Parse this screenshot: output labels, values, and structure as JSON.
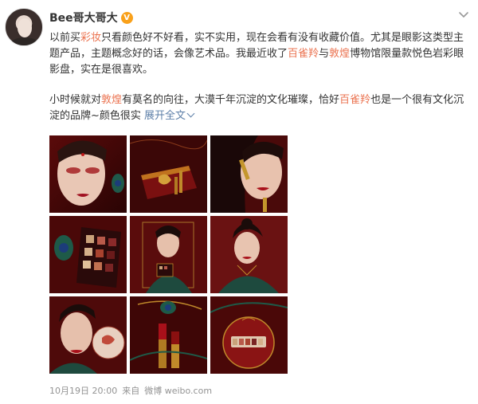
{
  "author": {
    "name": "Bee哥大哥大",
    "verified_badge": "V"
  },
  "post": {
    "p1": [
      {
        "t": "以前买",
        "kw": false
      },
      {
        "t": "彩妆",
        "kw": true
      },
      {
        "t": "只看颜色好不好看，实不实用，现在会看有没有收藏价值。尤其是眼影这类型主题产品，主题概念好的话，会像艺术品。我最近收了",
        "kw": false
      },
      {
        "t": "百雀羚",
        "kw": true
      },
      {
        "t": "与",
        "kw": false
      },
      {
        "t": "敦煌",
        "kw": true
      },
      {
        "t": "博物馆限量款悦色岩彩眼影盘，实在是很喜欢。",
        "kw": false
      }
    ],
    "p2": [
      {
        "t": "小时候就对",
        "kw": false
      },
      {
        "t": "敦煌",
        "kw": true
      },
      {
        "t": "有莫名的向往，大漠千年沉淀的文化璀璨，恰好",
        "kw": false
      },
      {
        "t": "百雀羚",
        "kw": true
      },
      {
        "t": "也是一个很有文化沉淀的品牌~颜色很实 ",
        "kw": false
      }
    ],
    "expand_label": "展开全文"
  },
  "photos": [
    {
      "name": "photo-1-model-closeup"
    },
    {
      "name": "photo-2-palette-case"
    },
    {
      "name": "photo-3-model-lipstick"
    },
    {
      "name": "photo-4-eyeshadow-palette"
    },
    {
      "name": "photo-5-model-holding-palette"
    },
    {
      "name": "photo-6-model-portrait"
    },
    {
      "name": "photo-7-model-with-fan"
    },
    {
      "name": "photo-8-lipsticks-peacock"
    },
    {
      "name": "photo-9-round-compact"
    }
  ],
  "footer": {
    "date": "10月19日 20:00",
    "from": "来自",
    "source": "微博 weibo.com"
  },
  "colors": {
    "keyword": "#eb7350",
    "link": "#5d7fa8",
    "photo_red": "#7a1414",
    "photo_dark": "#3a0606"
  }
}
